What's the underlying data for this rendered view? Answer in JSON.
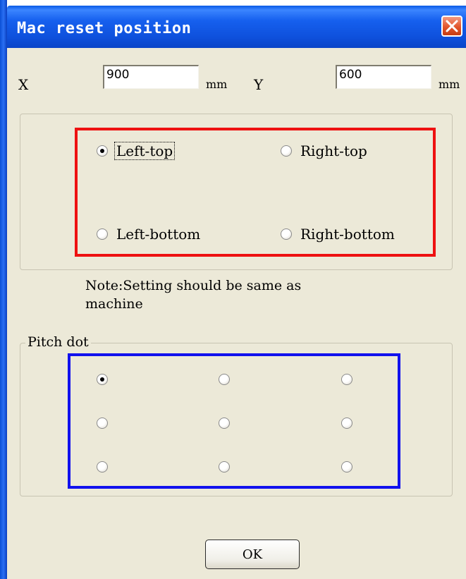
{
  "window": {
    "title": "Mac reset position",
    "close_icon": "close-x-icon",
    "colors": {
      "titlebar": "#0e50dc",
      "close": "#e2552b",
      "face": "#ece9d8"
    }
  },
  "coords": {
    "x_label": "X",
    "x_value": "900",
    "x_unit": "mm",
    "y_label": "Y",
    "y_value": "600",
    "y_unit": "mm"
  },
  "reset_position": {
    "highlight_color": "#ee1111",
    "selected": "Left-top",
    "options": [
      {
        "label": "Left-top",
        "checked": true
      },
      {
        "label": "Right-top",
        "checked": false
      },
      {
        "label": "Left-bottom",
        "checked": false
      },
      {
        "label": "Right-bottom",
        "checked": false
      }
    ]
  },
  "note": {
    "line1": "Note:Setting should be same as",
    "line2": "machine"
  },
  "pitch_dot": {
    "legend": "Pitch dot",
    "highlight_color": "#1111ee",
    "rows": [
      [
        true,
        false,
        false
      ],
      [
        false,
        false,
        false
      ],
      [
        false,
        false,
        false
      ]
    ]
  },
  "ok_button": {
    "label": "OK"
  }
}
